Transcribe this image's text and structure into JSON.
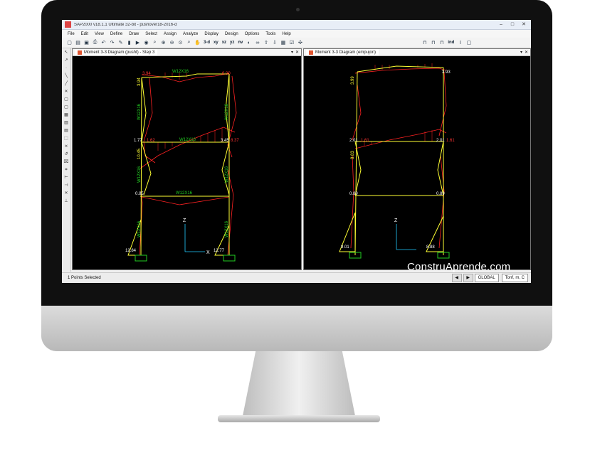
{
  "window": {
    "title": "SAP2000 v18.1.1 Ultimate 32-bit - pushover18-2016-d"
  },
  "menu": [
    "File",
    "Edit",
    "View",
    "Define",
    "Draw",
    "Select",
    "Assign",
    "Analyze",
    "Display",
    "Design",
    "Options",
    "Tools",
    "Help"
  ],
  "toolbar": {
    "view3d": "3-d",
    "xy": "xy",
    "xz": "xz",
    "yz": "yz",
    "nv": "nv",
    "ind": "ind"
  },
  "panes": {
    "left": {
      "tab": "Moment 3-3 Diagram (pusht) - Step 3",
      "beam_labels": [
        "W12X16",
        "W12X16",
        "W12X16"
      ],
      "col_left_labels": [
        "W12X16",
        "W12X16",
        "W12X16"
      ],
      "col_right_labels": [
        "W12X16",
        "W12X16",
        "W12X16"
      ],
      "values": {
        "top_left": "3.94",
        "top_left_h": "3.94",
        "top_right": "6.00",
        "mid_left": "1.77",
        "mid_left2": "1.62",
        "mid_left_v": "10.45",
        "mid_right": "3.45",
        "mid_right2": "8.37",
        "low_left": "0.85",
        "base_left": "12.84",
        "base_right": "12.77"
      }
    },
    "right": {
      "tab": "Moment 3-3 Diagram (empujon)",
      "values": {
        "top_left": "3.99",
        "top_right": "3.93",
        "mid_left": "2.01",
        "mid_left2": "1.61",
        "mid_left_v": "8.83",
        "mid_right": "2.01",
        "mid_right2": "1.61",
        "low_left": "0.89",
        "low_right": "0.89",
        "base_left": "9.01",
        "base_right": "8.88"
      }
    },
    "axis": {
      "z": "Z",
      "x": "X"
    }
  },
  "status": {
    "text": "1 Points Selected",
    "coord": "GLOBAL",
    "units": "Tonf, m, C"
  },
  "watermark": "ConstruAprende.com",
  "colors": {
    "frame": "#ffff33",
    "diagram": "#ff2222",
    "label": "#22cc22",
    "bezel": "#101010"
  }
}
